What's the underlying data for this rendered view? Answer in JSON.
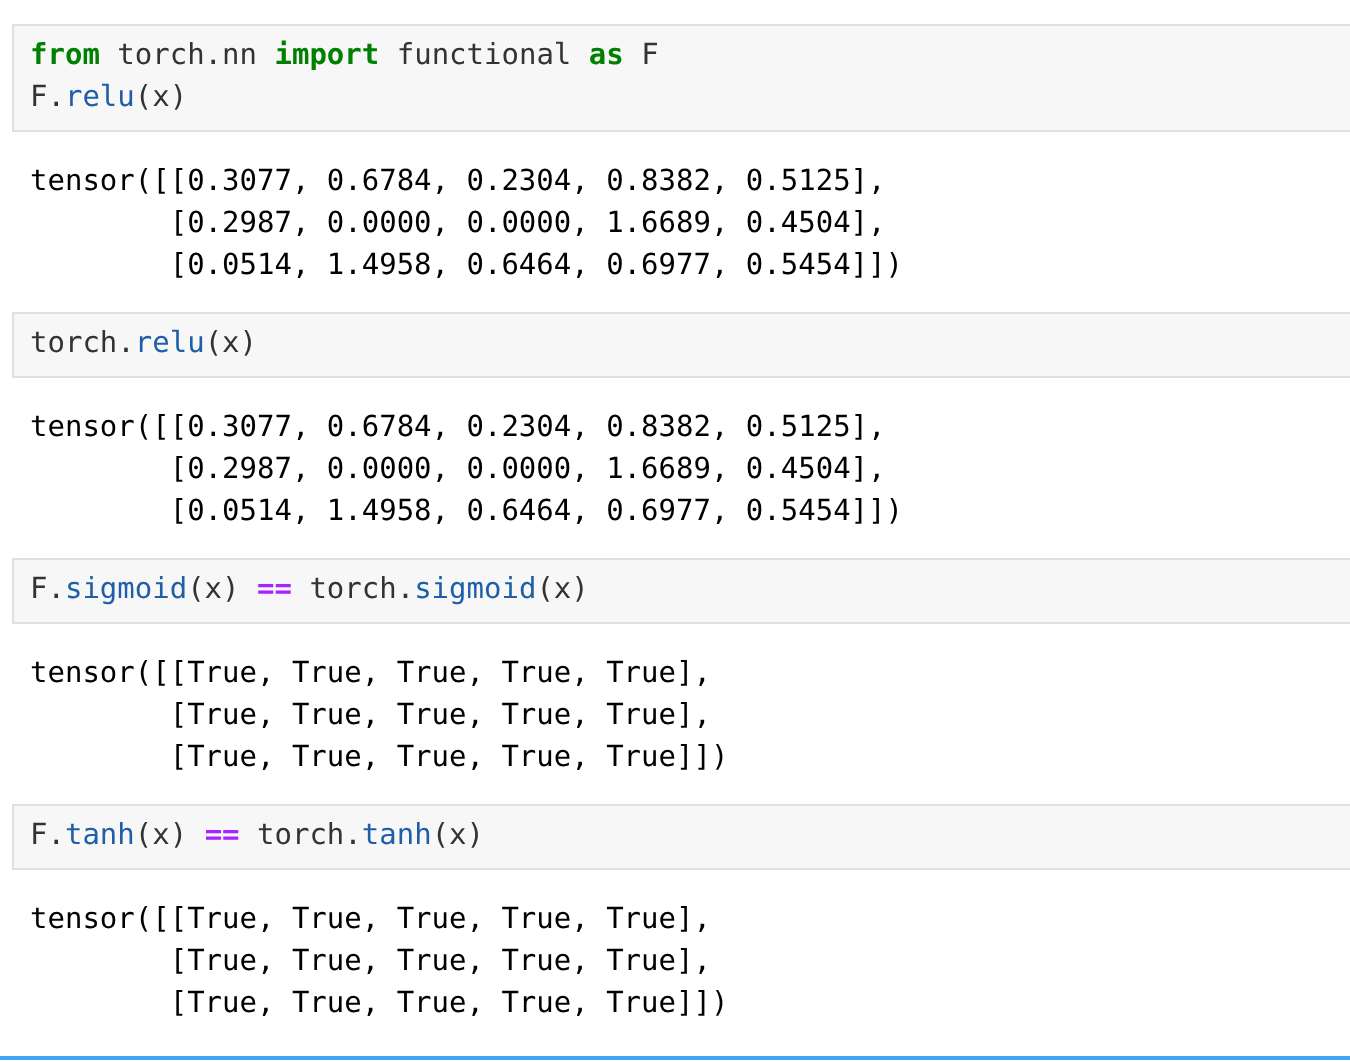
{
  "cells": [
    {
      "input": [
        [
          {
            "text": "from",
            "kind": "keyword"
          },
          {
            "text": " torch.nn ",
            "kind": "plain"
          },
          {
            "text": "import",
            "kind": "keyword"
          },
          {
            "text": " functional ",
            "kind": "plain"
          },
          {
            "text": "as",
            "kind": "keyword"
          },
          {
            "text": " F",
            "kind": "plain"
          }
        ],
        [
          {
            "text": "F.",
            "kind": "plain"
          },
          {
            "text": "relu",
            "kind": "attr"
          },
          {
            "text": "(x)",
            "kind": "plain"
          }
        ]
      ],
      "output": [
        "tensor([[0.3077, 0.6784, 0.2304, 0.8382, 0.5125],",
        "        [0.2987, 0.0000, 0.0000, 1.6689, 0.4504],",
        "        [0.0514, 1.4958, 0.6464, 0.6977, 0.5454]])"
      ]
    },
    {
      "input": [
        [
          {
            "text": "torch.",
            "kind": "plain"
          },
          {
            "text": "relu",
            "kind": "attr"
          },
          {
            "text": "(x)",
            "kind": "plain"
          }
        ]
      ],
      "output": [
        "tensor([[0.3077, 0.6784, 0.2304, 0.8382, 0.5125],",
        "        [0.2987, 0.0000, 0.0000, 1.6689, 0.4504],",
        "        [0.0514, 1.4958, 0.6464, 0.6977, 0.5454]])"
      ]
    },
    {
      "input": [
        [
          {
            "text": "F.",
            "kind": "plain"
          },
          {
            "text": "sigmoid",
            "kind": "attr"
          },
          {
            "text": "(x) ",
            "kind": "plain"
          },
          {
            "text": "==",
            "kind": "operator"
          },
          {
            "text": " torch.",
            "kind": "plain"
          },
          {
            "text": "sigmoid",
            "kind": "attr"
          },
          {
            "text": "(x)",
            "kind": "plain"
          }
        ]
      ],
      "output": [
        "tensor([[True, True, True, True, True],",
        "        [True, True, True, True, True],",
        "        [True, True, True, True, True]])"
      ]
    },
    {
      "input": [
        [
          {
            "text": "F.",
            "kind": "plain"
          },
          {
            "text": "tanh",
            "kind": "attr"
          },
          {
            "text": "(x) ",
            "kind": "plain"
          },
          {
            "text": "==",
            "kind": "operator"
          },
          {
            "text": " torch.",
            "kind": "plain"
          },
          {
            "text": "tanh",
            "kind": "attr"
          },
          {
            "text": "(x)",
            "kind": "plain"
          }
        ]
      ],
      "output": [
        "tensor([[True, True, True, True, True],",
        "        [True, True, True, True, True],",
        "        [True, True, True, True, True]])"
      ]
    }
  ]
}
